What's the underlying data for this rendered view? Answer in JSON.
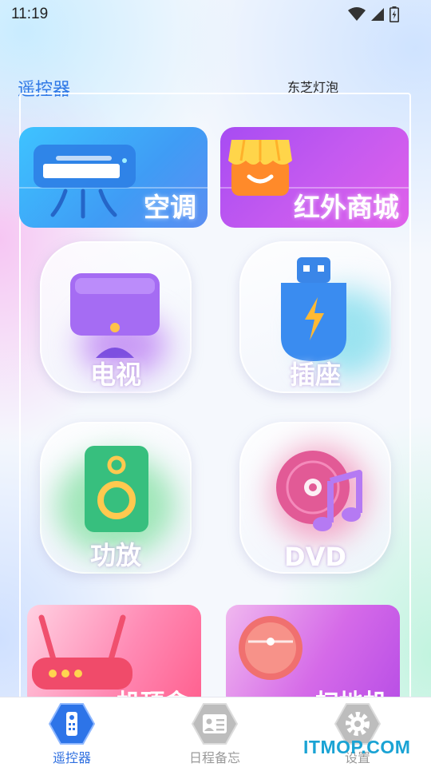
{
  "status_bar": {
    "time": "11:19"
  },
  "header": {
    "title": "遥控器",
    "device": "东芝灯泡"
  },
  "banners": {
    "ac": {
      "label": "空调"
    },
    "shop": {
      "label": "红外商城"
    }
  },
  "tiles": {
    "tv": {
      "label": "电视"
    },
    "plug": {
      "label": "插座"
    },
    "amp": {
      "label": "功放"
    },
    "dvd": {
      "label": "DVD"
    }
  },
  "bottom_banners": {
    "box": {
      "label": "机顶盒"
    },
    "robot": {
      "label": "扫地机"
    }
  },
  "tab_bar": {
    "items": [
      {
        "label": "遥控器",
        "icon": "remote-icon",
        "active": true
      },
      {
        "label": "日程备忘",
        "icon": "schedule-icon",
        "active": false
      },
      {
        "label": "设置",
        "icon": "gear-icon",
        "active": false
      }
    ]
  },
  "watermark": "ITMOP.COM",
  "colors": {
    "accent": "#2e6fe0",
    "title": "#2e78e6",
    "inactive": "#9a9a9a"
  }
}
